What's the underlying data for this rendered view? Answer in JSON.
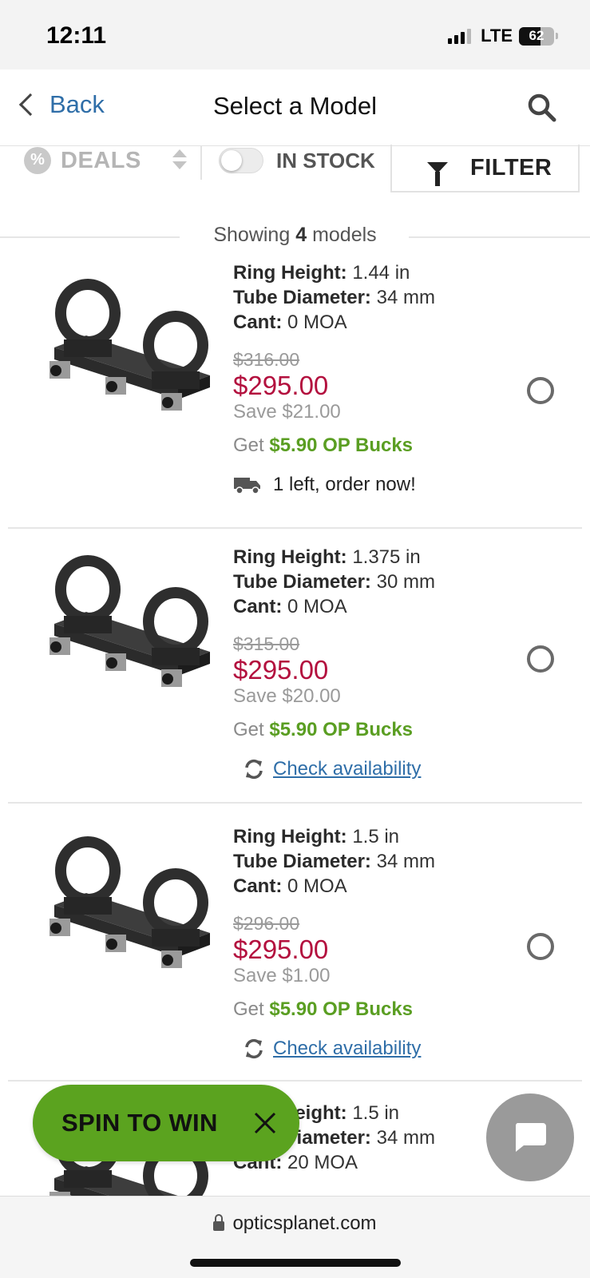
{
  "status_bar": {
    "time": "12:11",
    "network": "LTE",
    "battery_percent": 62,
    "battery_label": "62"
  },
  "nav": {
    "back_label": "Back",
    "title": "Select a Model"
  },
  "filters": {
    "deals_label": "DEALS",
    "in_stock_label": "IN STOCK",
    "in_stock_on": false,
    "filter_label": "FILTER"
  },
  "showing": {
    "prefix": "Showing",
    "count": "4",
    "suffix": "models"
  },
  "products": [
    {
      "ring_height_label": "Ring Height:",
      "ring_height": "1.44 in",
      "tube_label": "Tube Diameter:",
      "tube": "34 mm",
      "cant_label": "Cant:",
      "cant": "0 MOA",
      "old_price": "$316.00",
      "price": "$295.00",
      "save": "Save $21.00",
      "bucks_prefix": "Get",
      "bucks": "$5.90 OP Bucks",
      "availability": "1 left, order now!",
      "availability_type": "ship"
    },
    {
      "ring_height_label": "Ring Height:",
      "ring_height": "1.375 in",
      "tube_label": "Tube Diameter:",
      "tube": "30 mm",
      "cant_label": "Cant:",
      "cant": "0 MOA",
      "old_price": "$315.00",
      "price": "$295.00",
      "save": "Save $20.00",
      "bucks_prefix": "Get",
      "bucks": "$5.90 OP Bucks",
      "availability": "Check availability",
      "availability_type": "link"
    },
    {
      "ring_height_label": "Ring Height:",
      "ring_height": "1.5 in",
      "tube_label": "Tube Diameter:",
      "tube": "34 mm",
      "cant_label": "Cant:",
      "cant": "0 MOA",
      "old_price": "$296.00",
      "price": "$295.00",
      "save": "Save $1.00",
      "bucks_prefix": "Get",
      "bucks": "$5.90 OP Bucks",
      "availability": "Check availability",
      "availability_type": "link"
    },
    {
      "ring_height_label": "Ring Height:",
      "ring_height": "1.5 in",
      "tube_label": "Tube Diameter:",
      "tube": "34 mm",
      "cant_label": "Cant:",
      "cant": "20 MOA"
    }
  ],
  "promo": {
    "spin_label": "SPIN TO WIN"
  },
  "browser": {
    "url": "opticsplanet.com"
  },
  "colors": {
    "link_blue": "#2f6ea8",
    "sale_red": "#b3103e",
    "bucks_green": "#5a9e22",
    "promo_green": "#5ba31f"
  },
  "icons": [
    "signal-icon",
    "battery-icon",
    "back-chevron-icon",
    "search-icon",
    "deals-icon",
    "sort-icon",
    "filter-icon",
    "truck-icon",
    "refresh-icon",
    "radio-icon",
    "close-icon",
    "chat-icon",
    "lock-icon"
  ]
}
